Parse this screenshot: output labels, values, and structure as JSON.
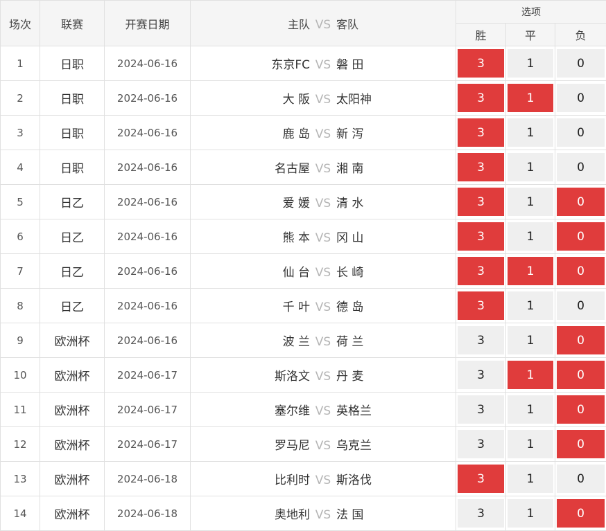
{
  "headers": {
    "no": "场次",
    "league": "联赛",
    "date": "开赛日期",
    "home": "主队",
    "vs": "VS",
    "away": "客队",
    "options": "选项",
    "win": "胜",
    "draw": "平",
    "lose": "负"
  },
  "colors": {
    "selected": "#e03c3c",
    "unselected": "#efefef",
    "header_bg": "#f5f5f5"
  },
  "rows": [
    {
      "no": "1",
      "league": "日职",
      "date": "2024-06-16",
      "home": "东京FC",
      "away": "磐 田",
      "win": "3",
      "draw": "1",
      "lose": "0",
      "win_sel": true,
      "draw_sel": false,
      "lose_sel": false
    },
    {
      "no": "2",
      "league": "日职",
      "date": "2024-06-16",
      "home": "大 阪",
      "away": "太阳神",
      "win": "3",
      "draw": "1",
      "lose": "0",
      "win_sel": true,
      "draw_sel": true,
      "lose_sel": false
    },
    {
      "no": "3",
      "league": "日职",
      "date": "2024-06-16",
      "home": "鹿 岛",
      "away": "新 泻",
      "win": "3",
      "draw": "1",
      "lose": "0",
      "win_sel": true,
      "draw_sel": false,
      "lose_sel": false
    },
    {
      "no": "4",
      "league": "日职",
      "date": "2024-06-16",
      "home": "名古屋",
      "away": "湘 南",
      "win": "3",
      "draw": "1",
      "lose": "0",
      "win_sel": true,
      "draw_sel": false,
      "lose_sel": false
    },
    {
      "no": "5",
      "league": "日乙",
      "date": "2024-06-16",
      "home": "爱 媛",
      "away": "清 水",
      "win": "3",
      "draw": "1",
      "lose": "0",
      "win_sel": true,
      "draw_sel": false,
      "lose_sel": true
    },
    {
      "no": "6",
      "league": "日乙",
      "date": "2024-06-16",
      "home": "熊 本",
      "away": "冈 山",
      "win": "3",
      "draw": "1",
      "lose": "0",
      "win_sel": true,
      "draw_sel": false,
      "lose_sel": true
    },
    {
      "no": "7",
      "league": "日乙",
      "date": "2024-06-16",
      "home": "仙 台",
      "away": "长 崎",
      "win": "3",
      "draw": "1",
      "lose": "0",
      "win_sel": true,
      "draw_sel": true,
      "lose_sel": true
    },
    {
      "no": "8",
      "league": "日乙",
      "date": "2024-06-16",
      "home": "千 叶",
      "away": "德 岛",
      "win": "3",
      "draw": "1",
      "lose": "0",
      "win_sel": true,
      "draw_sel": false,
      "lose_sel": false
    },
    {
      "no": "9",
      "league": "欧洲杯",
      "date": "2024-06-16",
      "home": "波 兰",
      "away": "荷 兰",
      "win": "3",
      "draw": "1",
      "lose": "0",
      "win_sel": false,
      "draw_sel": false,
      "lose_sel": true
    },
    {
      "no": "10",
      "league": "欧洲杯",
      "date": "2024-06-17",
      "home": "斯洛文",
      "away": "丹 麦",
      "win": "3",
      "draw": "1",
      "lose": "0",
      "win_sel": false,
      "draw_sel": true,
      "lose_sel": true
    },
    {
      "no": "11",
      "league": "欧洲杯",
      "date": "2024-06-17",
      "home": "塞尔维",
      "away": "英格兰",
      "win": "3",
      "draw": "1",
      "lose": "0",
      "win_sel": false,
      "draw_sel": false,
      "lose_sel": true
    },
    {
      "no": "12",
      "league": "欧洲杯",
      "date": "2024-06-17",
      "home": "罗马尼",
      "away": "乌克兰",
      "win": "3",
      "draw": "1",
      "lose": "0",
      "win_sel": false,
      "draw_sel": false,
      "lose_sel": true
    },
    {
      "no": "13",
      "league": "欧洲杯",
      "date": "2024-06-18",
      "home": "比利时",
      "away": "斯洛伐",
      "win": "3",
      "draw": "1",
      "lose": "0",
      "win_sel": true,
      "draw_sel": false,
      "lose_sel": false
    },
    {
      "no": "14",
      "league": "欧洲杯",
      "date": "2024-06-18",
      "home": "奥地利",
      "away": "法 国",
      "win": "3",
      "draw": "1",
      "lose": "0",
      "win_sel": false,
      "draw_sel": false,
      "lose_sel": true
    }
  ]
}
